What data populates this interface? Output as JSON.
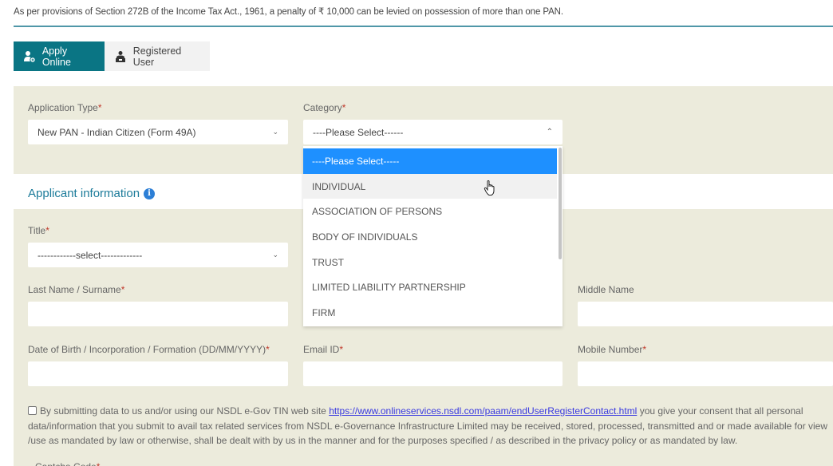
{
  "notice": "As per provisions of Section 272B of the Income Tax Act., 1961, a penalty of ₹ 10,000 can be levied on possession of more than one PAN.",
  "tabs": [
    {
      "label": "Apply Online",
      "icon": "user-add-icon",
      "active": true
    },
    {
      "label": "Registered User",
      "icon": "registered-user-icon",
      "active": false
    }
  ],
  "application": {
    "type_label": "Application Type",
    "type_value": "New PAN - Indian Citizen (Form 49A)",
    "category_label": "Category",
    "category_value": "----Please Select------",
    "required_mark": "*"
  },
  "category_dropdown": {
    "options": [
      "----Please Select-----",
      "INDIVIDUAL",
      "ASSOCIATION OF PERSONS",
      "BODY OF INDIVIDUALS",
      "TRUST",
      "LIMITED LIABILITY PARTNERSHIP",
      "FIRM"
    ],
    "selected_index": 0,
    "hover_index": 1
  },
  "applicant": {
    "section_title": "Applicant information",
    "info_icon": "i",
    "title_label": "Title",
    "title_value": "------------select-------------",
    "last_name_label": "Last Name / Surname",
    "middle_name_label": "Middle Name",
    "dob_label": "Date of Birth / Incorporation / Formation (DD/MM/YYYY)",
    "email_label": "Email ID",
    "mobile_label": "Mobile Number",
    "last_name_value": "",
    "middle_name_value": "",
    "dob_value": "",
    "email_value": "",
    "mobile_value": ""
  },
  "consent": {
    "checked": false,
    "text_before": "By submitting data to us and/or using our NSDL e-Gov TIN web site ",
    "link": "https://www.onlineservices.nsdl.com/paam/endUserRegisterContact.html",
    "text_after": " you give your consent that all personal data/information that you submit to avail tax related services from NSDL e-Governance Infrastructure Limited may be received, stored, processed, transmitted and or made available for view /use as mandated by law or otherwise, shall be dealt with by us in the manner and for the purposes specified / as described in the privacy policy or as mandated by law."
  },
  "captcha_label": "Captcha Code"
}
